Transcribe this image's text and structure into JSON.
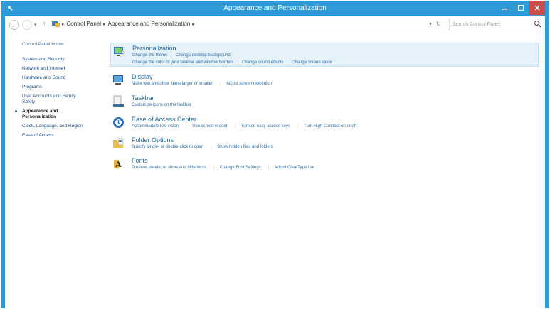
{
  "window": {
    "title": "Appearance and Personalization",
    "accent": "#2e9ad6",
    "close_color": "#c94d4d"
  },
  "addressbar": {
    "breadcrumbs": [
      "Control Panel",
      "Appearance and Personalization"
    ],
    "search_placeholder": "Search Control Panel"
  },
  "leftnav": {
    "items": [
      "Control Panel Home",
      "System and Security",
      "Network and Internet",
      "Hardware and Sound",
      "Programs",
      "User Accounts and Family Safety",
      "Appearance and Personalization",
      "Clock, Language, and Region",
      "Ease of Access"
    ]
  },
  "categories": [
    {
      "icon": "personalization-icon",
      "title": "Personalization",
      "links": [
        "Change the theme",
        "Change desktop background"
      ],
      "links2": [
        "Change the color of your taskbar and window borders",
        "Change sound effects",
        "Change screen saver"
      ]
    },
    {
      "icon": "display-icon",
      "title": "Display",
      "links": [
        "Make text and other items larger or smaller",
        "Adjust screen resolution"
      ]
    },
    {
      "icon": "taskbar-icon",
      "title": "Taskbar",
      "links": [
        "Customize icons on the taskbar"
      ]
    },
    {
      "icon": "ease-of-access-icon",
      "title": "Ease of Access Center",
      "links": [
        "Accommodate low vision",
        "Use screen reader",
        "Turn on easy access keys",
        "Turn High Contrast on or off"
      ]
    },
    {
      "icon": "folder-options-icon",
      "title": "Folder Options",
      "links": [
        "Specify single- or double-click to open",
        "Show hidden files and folders"
      ]
    },
    {
      "icon": "fonts-icon",
      "title": "Fonts",
      "links": [
        "Preview, delete, or show and hide fonts",
        "Change Font Settings",
        "Adjust ClearType text"
      ]
    }
  ]
}
